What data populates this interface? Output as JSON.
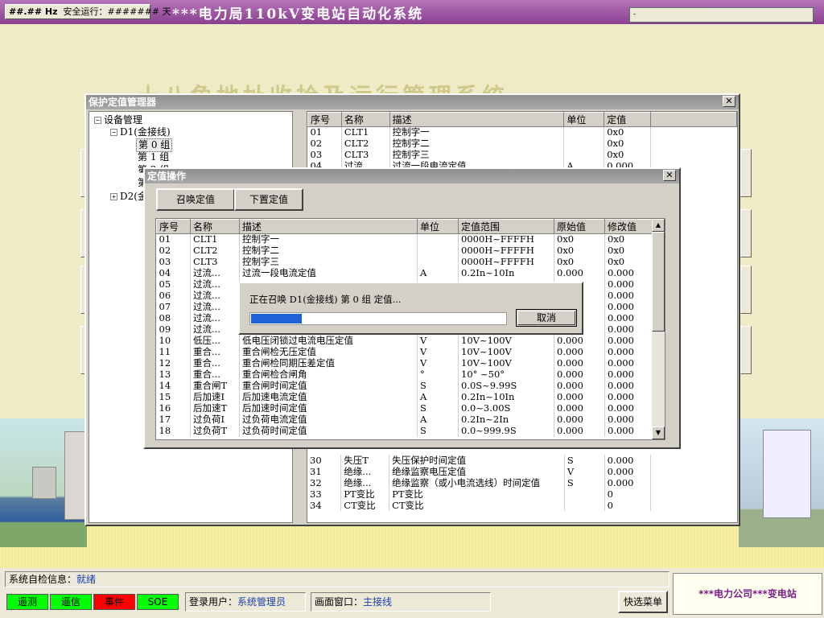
{
  "topbar": {
    "freq_text": "##.## Hz",
    "uptime_label": "安全运行：",
    "uptime_value": "####### 天",
    "title": "***电力局110kV变电站自动化系统",
    "right_box": "-"
  },
  "background": {
    "title": "十八角地址收拾及运行管理系统"
  },
  "manager": {
    "title": "保护定值管理器",
    "close": "✕",
    "tree": {
      "root": "设备管理",
      "d1": "D1(金接线)",
      "group0": "第 0 组",
      "group1": "第 1 组",
      "group2": "第 2 组",
      "group3": "第",
      "d2": "D2(金"
    },
    "columns": [
      "序号",
      "名称",
      "描述",
      "单位",
      "定值"
    ],
    "rows_top": [
      [
        "01",
        "CLT1",
        "控制字一",
        "",
        "0x0"
      ],
      [
        "02",
        "CLT2",
        "控制字二",
        "",
        "0x0"
      ],
      [
        "03",
        "CLT3",
        "控制字三",
        "",
        "0x0"
      ],
      [
        "04",
        "过流",
        "过流一段电流定值",
        "A",
        "0.000"
      ]
    ],
    "rows_bottom": [
      [
        "30",
        "失压T",
        "失压保护时间定值",
        "S",
        "0.000"
      ],
      [
        "31",
        "绝缘...",
        "绝缘监察电压定值",
        "V",
        "0.000"
      ],
      [
        "32",
        "绝缘...",
        "绝缘监察（或小电流选线）时间定值",
        "S",
        "0.000"
      ],
      [
        "33",
        "PT变比",
        "PT变比",
        "",
        "0"
      ],
      [
        "34",
        "CT变比",
        "CT变比",
        "",
        "0"
      ]
    ]
  },
  "operation": {
    "title": "定值操作",
    "close": "✕",
    "recall_button": "召唤定值",
    "download_button": "下置定值",
    "columns": [
      "序号",
      "名称",
      "描述",
      "单位",
      "定值范围",
      "原始值",
      "修改值"
    ],
    "rows": [
      [
        "01",
        "CLT1",
        "控制字一",
        "",
        "0000H~FFFFH",
        "0x0",
        "0x0"
      ],
      [
        "02",
        "CLT2",
        "控制字二",
        "",
        "0000H~FFFFH",
        "0x0",
        "0x0"
      ],
      [
        "03",
        "CLT3",
        "控制字三",
        "",
        "0000H~FFFFH",
        "0x0",
        "0x0"
      ],
      [
        "04",
        "过流...",
        "过流一段电流定值",
        "A",
        "0.2In~10In",
        "0.000",
        "0.000"
      ],
      [
        "05",
        "过流...",
        "",
        "",
        "",
        "",
        "0.000"
      ],
      [
        "06",
        "过流...",
        "",
        "",
        "",
        "",
        "0.000"
      ],
      [
        "07",
        "过流...",
        "",
        "",
        "",
        "",
        "0.000"
      ],
      [
        "08",
        "过流...",
        "",
        "",
        "",
        "",
        "0.000"
      ],
      [
        "09",
        "过流...",
        "",
        "",
        "",
        "",
        "0.000"
      ],
      [
        "10",
        "低压...",
        "低电压闭锁过电流电压定值",
        "V",
        "10V~100V",
        "0.000",
        "0.000"
      ],
      [
        "11",
        "重合...",
        "重合闸检无压定值",
        "V",
        "10V~100V",
        "0.000",
        "0.000"
      ],
      [
        "12",
        "重合...",
        "重合闸检同期压差定值",
        "V",
        "10V~100V",
        "0.000",
        "0.000"
      ],
      [
        "13",
        "重合...",
        "重合闸检合闸角",
        "°",
        "10° ~50°",
        "0.000",
        "0.000"
      ],
      [
        "14",
        "重合闸T",
        "重合闸时间定值",
        "S",
        "0.0S~9.99S",
        "0.000",
        "0.000"
      ],
      [
        "15",
        "后加速I",
        "后加速电流定值",
        "A",
        "0.2In~10In",
        "0.000",
        "0.000"
      ],
      [
        "16",
        "后加速T",
        "后加速时间定值",
        "S",
        "0.0~3.00S",
        "0.000",
        "0.000"
      ],
      [
        "17",
        "过负荷I",
        "过负荷电流定值",
        "A",
        "0.2In~2In",
        "0.000",
        "0.000"
      ],
      [
        "18",
        "过负荷T",
        "过负荷时间定值",
        "S",
        "0.0~999.9S",
        "0.000",
        "0.000"
      ]
    ],
    "scroll_up": "▲",
    "scroll_down": "▼"
  },
  "progress": {
    "message": "正在召唤 D1(金接线) 第 0 组 定值...",
    "cancel": "取消",
    "fraction": 0.2
  },
  "status": {
    "selfcheck_label": "系统自检信息：",
    "selfcheck_value": "就绪",
    "indicators": [
      {
        "label": "遥测",
        "color": "#00ff00"
      },
      {
        "label": "遥信",
        "color": "#00ff00"
      },
      {
        "label": "事件",
        "color": "#ff0000"
      },
      {
        "label": "SOE",
        "color": "#00ff00"
      }
    ],
    "user_label": "登录用户：",
    "user_value": "系统管理员",
    "window_label": "画面窗口：",
    "window_value": "主接线",
    "quick_menu": "快选菜单",
    "station": "***电力公司***变电站"
  }
}
